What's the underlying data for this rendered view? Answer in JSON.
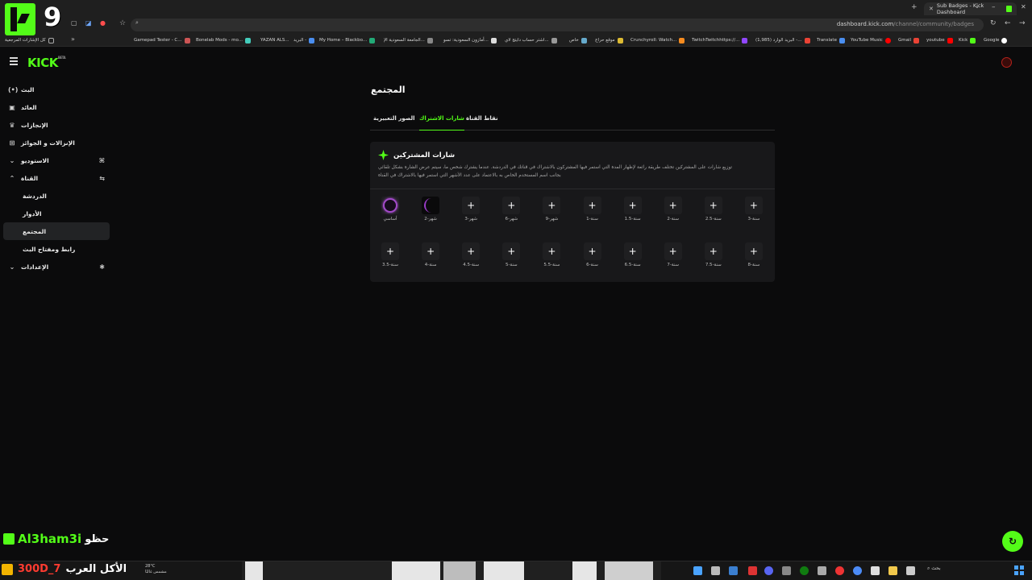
{
  "stream_overlay": {
    "logo_number": "9",
    "username": "Al3ham3i",
    "username_suffix": "حظو",
    "ticker_left": "300D_7",
    "ticker_right": "الأكل العرب"
  },
  "browser": {
    "active_tab": "Sub Badges - Kick Dashboard",
    "url_domain": "dashboard.kick.com",
    "url_path": "/channel/community/badges",
    "bookmarks_folder": "كل الإشارات المرجعية",
    "bookmarks": [
      "Gamepad Tester - C...",
      "Bonelab Mods - mo...",
      "YAZAN ALS...",
      "البريد -",
      "My Home – Blackbo...",
      "الجامعة السعودية الإ...",
      "أمازون السعودية: تسو...",
      "اشتر حساب دايتج لاي...",
      "خاص",
      "موقع حراج",
      "Crunchyroll: Watch...",
      "TwitchTwitchhttps://...",
      "(1,985) البريد الوارد -...",
      "Translate",
      "YouTube Music",
      "Gmail",
      "youtube",
      "Kick",
      "Google"
    ]
  },
  "header": {
    "logo": "KICK",
    "logo_badge": "BETA"
  },
  "sidebar": {
    "items": [
      {
        "label": "البث",
        "icon": "broadcast-icon"
      },
      {
        "label": "العائد",
        "icon": "revenue-icon"
      },
      {
        "label": "الإنجازات",
        "icon": "trophy-icon"
      },
      {
        "label": "الإنزالات و الجوائز",
        "icon": "gift-icon"
      },
      {
        "label": "الاستوديو",
        "icon": "studio-icon"
      },
      {
        "label": "القناة",
        "icon": "channel-icon"
      },
      {
        "label": "الدردشة",
        "icon": ""
      },
      {
        "label": "الأدوار",
        "icon": ""
      },
      {
        "label": "المجتمع",
        "icon": ""
      },
      {
        "label": "رابط ومفتاح البث",
        "icon": ""
      },
      {
        "label": "الإعدادات",
        "icon": "gear-icon"
      }
    ]
  },
  "main": {
    "title": "المجتمع",
    "tabs": [
      "نقاط القناة",
      "شارات الاشتراك",
      "الصور التعبيرية"
    ],
    "active_tab": "شارات الاشتراك",
    "card": {
      "title": "شارات المشتركين",
      "description_1": "توزيع شارات على المشتركين تختلف طريقة رائعة لإظهار المدة التي استمر فيها المشتركون بالاشتراك في قناتك في الدردشة. عندما يشترك شخص ما، سيتم عرض الشارة بشكل تلقائي",
      "description_2": "بجانب اسم المستخدم الخاص به بالاعتماد على عدد الأشهر التي استمر فيها بالاشتراك في القناة"
    },
    "badges": [
      "أساسي",
      "شهر-2",
      "شهر-3",
      "شهر-6",
      "شهر-9",
      "سنة-1",
      "سنة-1.5",
      "سنة-2",
      "سنة-2.5",
      "سنة-3",
      "سنة-3.5",
      "سنة-4",
      "سنة-4.5",
      "سنة-5",
      "سنة-5.5",
      "سنة-6",
      "سنة-6.5",
      "سنة-7",
      "سنة-7.5",
      "سنة-8"
    ]
  },
  "taskbar": {
    "search_label": "بحث",
    "weather_temp": "28°C",
    "weather_desc": "مشمس غالبًا"
  },
  "colors": {
    "accent": "#53fc18",
    "badge_purple": "#a24ac8",
    "background": "#0b0b0c",
    "card": "#18181a"
  }
}
